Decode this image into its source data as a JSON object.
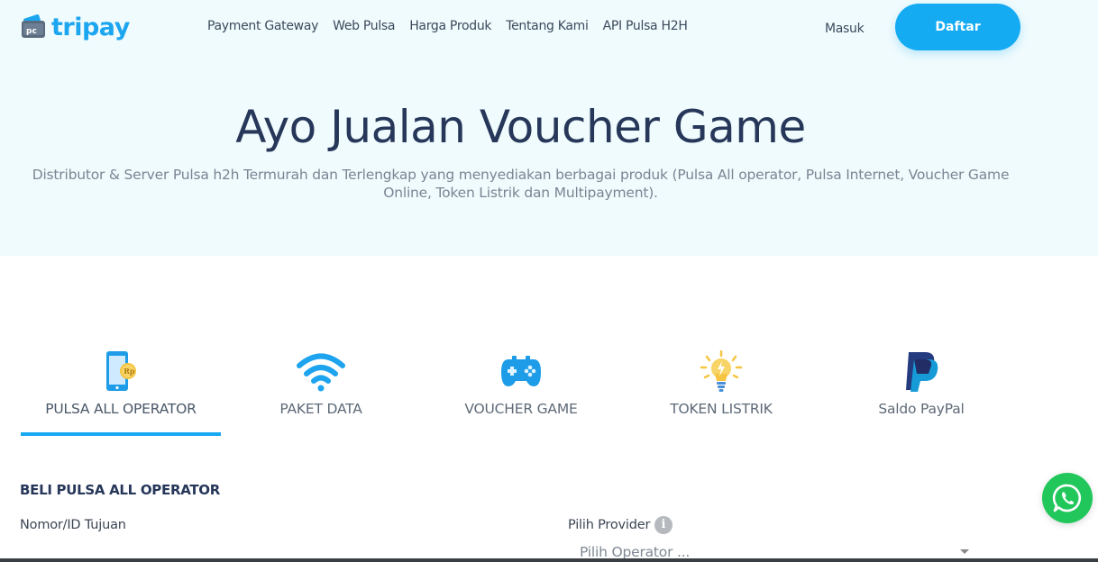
{
  "brand": {
    "name": "tripay",
    "color": "#1da6f0"
  },
  "nav": {
    "items": [
      {
        "label": "Payment Gateway"
      },
      {
        "label": "Web Pulsa"
      },
      {
        "label": "Harga Produk"
      },
      {
        "label": "Tentang Kami"
      },
      {
        "label": "API Pulsa H2H"
      }
    ],
    "login_label": "Masuk",
    "register_label": "Daftar"
  },
  "hero": {
    "title": "Ayo Jualan Voucher Game",
    "subtitle": "Distributor & Server Pulsa h2h Termurah dan Terlengkap yang menyediakan berbagai produk (Pulsa All operator, Pulsa Internet, Voucher Game Online, Token Listrik dan Multipayment)."
  },
  "tabs": [
    {
      "label": "PULSA ALL OPERATOR",
      "icon": "phone-rupiah-icon",
      "active": true
    },
    {
      "label": "PAKET DATA",
      "icon": "wifi-icon",
      "active": false
    },
    {
      "label": "VOUCHER GAME",
      "icon": "gamepad-icon",
      "active": false
    },
    {
      "label": "TOKEN LISTRIK",
      "icon": "lightbulb-icon",
      "active": false
    },
    {
      "label": "Saldo PayPal",
      "icon": "paypal-icon",
      "active": false
    }
  ],
  "form": {
    "section_title": "BELI PULSA ALL OPERATOR",
    "target_label": "Nomor/ID Tujuan",
    "provider_label": "Pilih Provider",
    "provider_placeholder": "Pilih Operator ..."
  },
  "colors": {
    "accent": "#14abf3",
    "hero_bg": "#f0fbfd",
    "whatsapp": "#22c75c"
  }
}
